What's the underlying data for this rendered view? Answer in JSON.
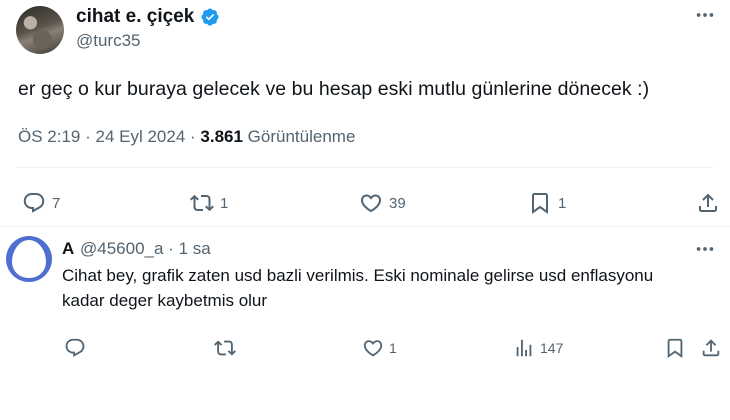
{
  "tweet": {
    "author_name": "cihat e. çiçek",
    "author_handle": "@turc35",
    "text": "er geç o kur buraya gelecek ve bu hesap eski mutlu günlerine dönecek :)",
    "time": "ÖS 2:19",
    "date": "24 Eyl 2024",
    "views_count": "3.861",
    "views_label": "Görüntülenme",
    "separator": " · ",
    "actions": {
      "replies": "7",
      "retweets": "1",
      "likes": "39",
      "bookmarks": "1"
    }
  },
  "reply": {
    "author_name": "A",
    "author_handle": "@45600_a",
    "time": "1 sa",
    "separator": " · ",
    "text": "Cihat bey, grafik zaten usd bazli verilmis. Eski nominale gelirse usd enflasyonu kadar deger kaybetmis olur",
    "actions": {
      "replies": "",
      "retweets": "",
      "likes": "1",
      "views": "147"
    }
  },
  "icons": [
    "verified-badge-icon",
    "more-icon",
    "reply-icon",
    "retweet-icon",
    "like-icon",
    "bookmark-icon",
    "share-icon",
    "views-icon"
  ],
  "colors": {
    "verified": "#1d9bf0",
    "secondary_text": "#536471",
    "primary_text": "#0f1419",
    "divider": "#eff3f4",
    "reply_avatar": "#4f6fd0"
  }
}
